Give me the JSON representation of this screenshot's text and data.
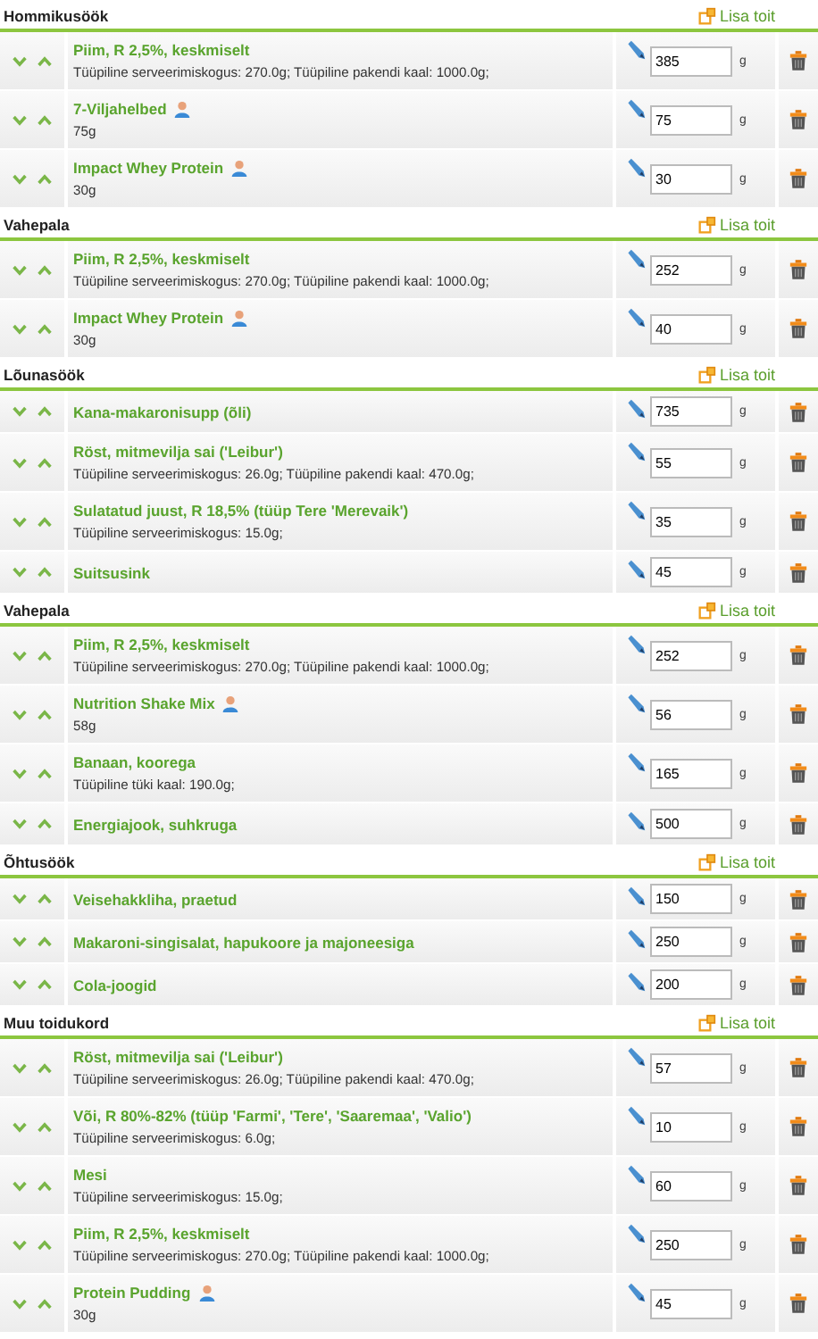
{
  "meals": [
    {
      "title": "Hommikusöök",
      "add_label": "Lisa toit",
      "items": [
        {
          "name": "Piim, R 2,5%, keskmiselt",
          "own_food": false,
          "detail": "Tüüpiline serveerimiskogus: 270.0g; Tüüpiline pakendi kaal: 1000.0g;",
          "amount": "385",
          "unit": "g"
        },
        {
          "name": "7-Viljahelbed",
          "own_food": true,
          "detail": "75g",
          "amount": "75",
          "unit": "g"
        },
        {
          "name": "Impact Whey Protein",
          "own_food": true,
          "detail": "30g",
          "amount": "30",
          "unit": "g"
        }
      ]
    },
    {
      "title": "Vahepala",
      "add_label": "Lisa toit",
      "items": [
        {
          "name": "Piim, R 2,5%, keskmiselt",
          "own_food": false,
          "detail": "Tüüpiline serveerimiskogus: 270.0g; Tüüpiline pakendi kaal: 1000.0g;",
          "amount": "252",
          "unit": "g"
        },
        {
          "name": "Impact Whey Protein",
          "own_food": true,
          "detail": "30g",
          "amount": "40",
          "unit": "g"
        }
      ]
    },
    {
      "title": "Lõunasöök",
      "add_label": "Lisa toit",
      "items": [
        {
          "name": "Kana-makaronisupp (õli)",
          "own_food": false,
          "amount": "735",
          "unit": "g"
        },
        {
          "name": "Röst, mitmevilja sai ('Leibur')",
          "own_food": false,
          "detail": "Tüüpiline serveerimiskogus: 26.0g; Tüüpiline pakendi kaal: 470.0g;",
          "amount": "55",
          "unit": "g"
        },
        {
          "name": "Sulatatud juust, R 18,5% (tüüp Tere 'Merevaik')",
          "own_food": false,
          "detail": "Tüüpiline serveerimiskogus: 15.0g;",
          "amount": "35",
          "unit": "g"
        },
        {
          "name": "Suitsusink",
          "own_food": false,
          "amount": "45",
          "unit": "g"
        }
      ]
    },
    {
      "title": "Vahepala",
      "add_label": "Lisa toit",
      "items": [
        {
          "name": "Piim, R 2,5%, keskmiselt",
          "own_food": false,
          "detail": "Tüüpiline serveerimiskogus: 270.0g; Tüüpiline pakendi kaal: 1000.0g;",
          "amount": "252",
          "unit": "g"
        },
        {
          "name": "Nutrition Shake Mix",
          "own_food": true,
          "detail": "58g",
          "amount": "56",
          "unit": "g"
        },
        {
          "name": "Banaan, koorega",
          "own_food": false,
          "detail": "Tüüpiline tüki kaal: 190.0g;",
          "amount": "165",
          "unit": "g"
        },
        {
          "name": "Energiajook, suhkruga",
          "own_food": false,
          "amount": "500",
          "unit": "g"
        }
      ]
    },
    {
      "title": "Õhtusöök",
      "add_label": "Lisa toit",
      "items": [
        {
          "name": "Veisehakkliha, praetud",
          "own_food": false,
          "amount": "150",
          "unit": "g"
        },
        {
          "name": "Makaroni-singisalat, hapukoore ja majoneesiga",
          "own_food": false,
          "amount": "250",
          "unit": "g"
        },
        {
          "name": "Cola-joogid",
          "own_food": false,
          "amount": "200",
          "unit": "g"
        }
      ]
    },
    {
      "title": "Muu toidukord",
      "add_label": "Lisa toit",
      "items": [
        {
          "name": "Röst, mitmevilja sai ('Leibur')",
          "own_food": false,
          "detail": "Tüüpiline serveerimiskogus: 26.0g; Tüüpiline pakendi kaal: 470.0g;",
          "amount": "57",
          "unit": "g"
        },
        {
          "name": "Või, R 80%-82% (tüüp 'Farmi', 'Tere', 'Saaremaa', 'Valio')",
          "own_food": false,
          "detail": "Tüüpiline serveerimiskogus: 6.0g;",
          "amount": "10",
          "unit": "g"
        },
        {
          "name": "Mesi",
          "own_food": false,
          "detail": "Tüüpiline serveerimiskogus: 15.0g;",
          "amount": "60",
          "unit": "g"
        },
        {
          "name": "Piim, R 2,5%, keskmiselt",
          "own_food": false,
          "detail": "Tüüpiline serveerimiskogus: 270.0g; Tüüpiline pakendi kaal: 1000.0g;",
          "amount": "250",
          "unit": "g"
        },
        {
          "name": "Protein Pudding",
          "own_food": true,
          "detail": "30g",
          "amount": "45",
          "unit": "g"
        }
      ]
    }
  ]
}
